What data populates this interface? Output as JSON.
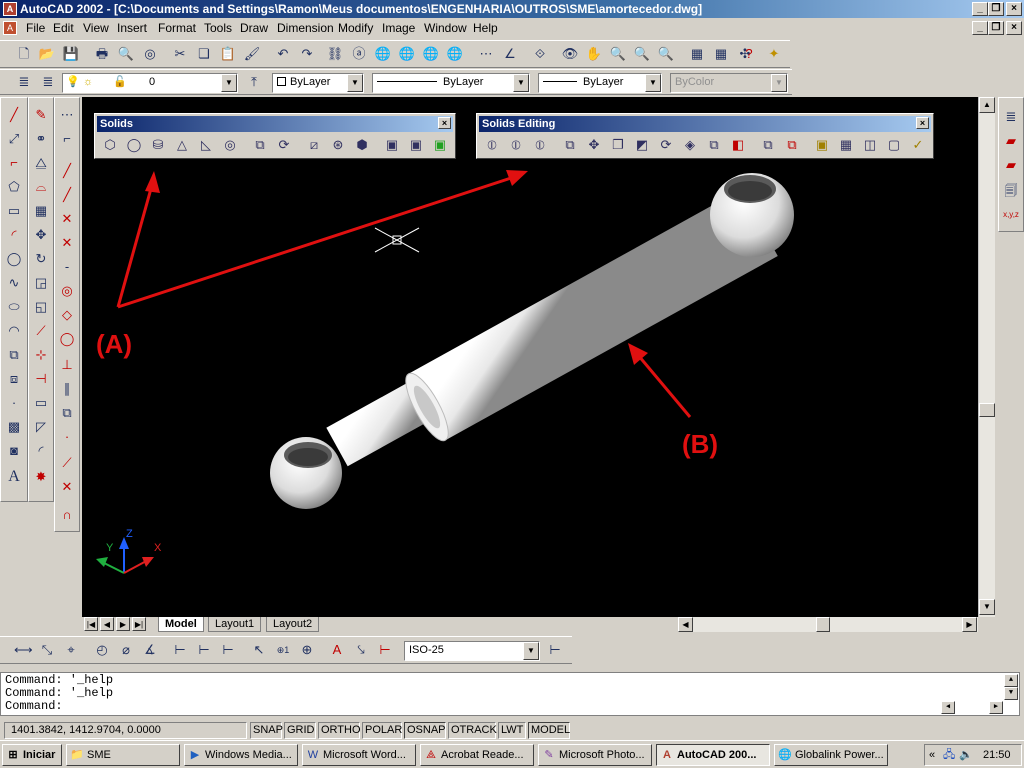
{
  "window": {
    "title": "AutoCAD 2002 - [C:\\Documents and Settings\\Ramon\\Meus documentos\\ENGENHARIA\\OUTROS\\SME\\amortecedor.dwg]"
  },
  "menu": [
    "File",
    "Edit",
    "View",
    "Insert",
    "Format",
    "Tools",
    "Draw",
    "Dimension",
    "Modify",
    "Image",
    "Window",
    "Help"
  ],
  "layers": {
    "current": "0",
    "color": "ByLayer",
    "linetype": "ByLayer",
    "lineweight": "ByLayer",
    "plotstyle": "ByColor"
  },
  "solids": {
    "title": "Solids",
    "close": "×"
  },
  "solids_editing": {
    "title": "Solids Editing",
    "close": "×"
  },
  "annotations": {
    "a": "(A)",
    "b": "(B)"
  },
  "ucs": {
    "x": "X",
    "y": "Y",
    "z": "Z"
  },
  "tabs": [
    "Model",
    "Layout1",
    "Layout2"
  ],
  "dimstyle": "ISO-25",
  "command": {
    "lines": [
      "Command:  '_help",
      "Command:  '_help"
    ],
    "prompt": "Command:"
  },
  "status": {
    "coords": "1401.3842, 1412.9704, 0.0000",
    "toggles": [
      "SNAP",
      "GRID",
      "ORTHO",
      "POLAR",
      "OSNAP",
      "OTRACK",
      "LWT",
      "MODEL"
    ]
  },
  "taskbar": {
    "start": "Iniciar",
    "tasks": [
      "SME",
      "Windows Media...",
      "Microsoft Word...",
      "Acrobat Reade...",
      "Microsoft Photo...",
      "AutoCAD 200...",
      "Globalink Power..."
    ],
    "clock": "21:50"
  },
  "colors": {
    "accent": "#0a246a",
    "annotation": "#e01010",
    "canvas": "#000000"
  }
}
